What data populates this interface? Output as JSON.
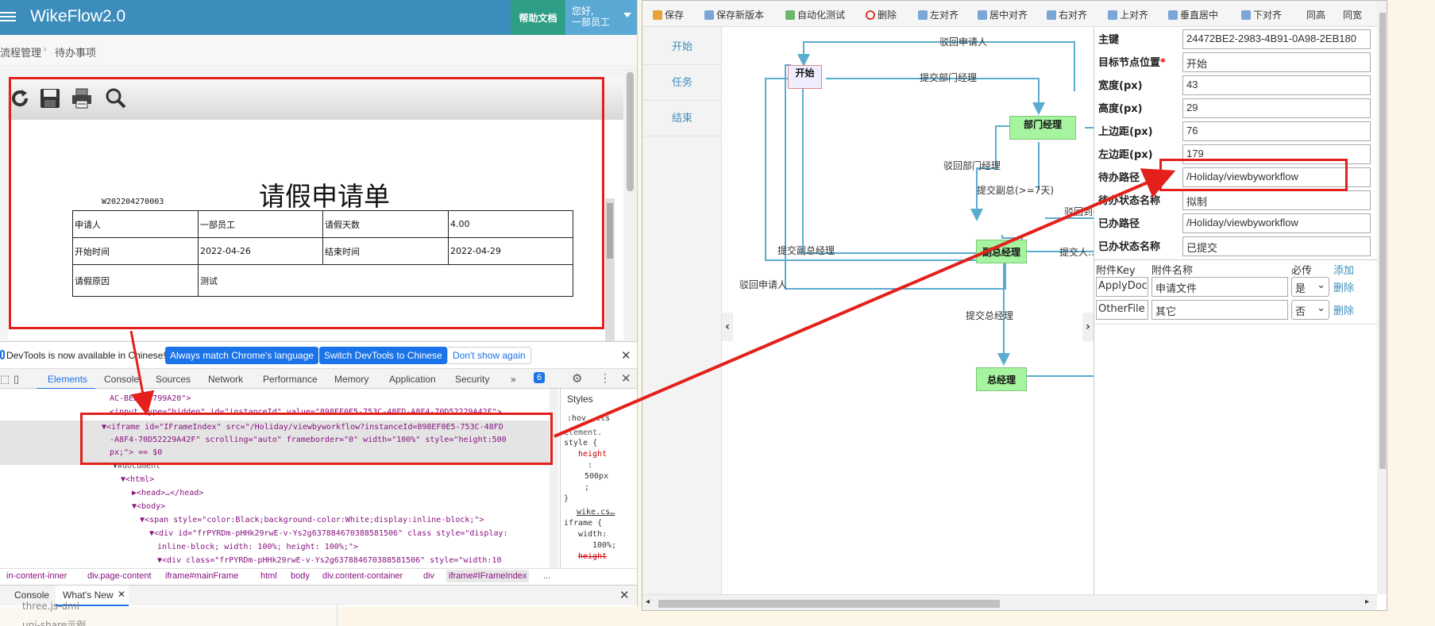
{
  "left": {
    "app_title": "WikeFlow2.0",
    "help_button": "帮助文档",
    "user_greeting": "您好,",
    "user_name": "一部员工",
    "breadcrumb": [
      "流程管理",
      "待办事项"
    ],
    "breadcrumb_sep": "›",
    "toolbar_icons": [
      "refresh-icon",
      "save-icon",
      "print-icon",
      "search-icon"
    ],
    "form": {
      "title": "请假申请单",
      "number": "W202204270003",
      "rows": [
        [
          "申请人",
          "一部员工",
          "请假天数",
          "4.00"
        ],
        [
          "开始时间",
          "2022-04-26",
          "结束时间",
          "2022-04-29"
        ],
        [
          "请假原因",
          "测试",
          "",
          ""
        ]
      ]
    }
  },
  "devtools": {
    "notice": "DevTools is now available in Chinese!",
    "btn_match": "Always match Chrome's language",
    "btn_switch": "Switch DevTools to Chinese",
    "btn_dont": "Don't show again",
    "tabs": [
      "Elements",
      "Console",
      "Sources",
      "Network",
      "Performance",
      "Memory",
      "Application",
      "Security"
    ],
    "more_tabs": "»",
    "issues_count": "6",
    "code_lines": [
      "AC-BEBBE5799A20\">",
      "<input type=\"hidden\" id=\"instanceId\" value=\"898EF0E5-753C-48FD-A8F4-70D52229A42F\">",
      "▼<iframe id=\"IFrameIndex\" src=\"/Holiday/viewbyworkflow?instanceId=898EF0E5-753C-48FD",
      "-A8F4-70D52229A42F\" scrolling=\"auto\" frameborder=\"0\" width=\"100%\" style=\"height:500",
      "px;\"> == $0",
      "▼#document",
      "▼<html>",
      "▶<head>…</head>",
      "▼<body>",
      "▼<span style=\"color:Black;background-color:White;display:inline-block;\">",
      "▼<div id=\"frPYRDm-pHHk29rwE-v-Ys2g637884670388581506\" class style=\"display:",
      "inline-block; width: 100%; height: 100%;\">",
      "▼<div class=\"frPYRDm-pHHk29rwE-v-Ys2g637884670388581506\" style=\"width:10"
    ],
    "styles_tab": "Styles",
    "styles_lines": [
      ":hov .cls",
      "element.",
      "style {",
      "height",
      ":",
      "500px",
      ";",
      "}",
      "wike.cs…",
      "iframe {",
      "width:",
      "100%;",
      "height"
    ],
    "crumbs": [
      "in-content-inner",
      "div.page-content",
      "iframe#mainFrame",
      "html",
      "body",
      "div.content-container",
      "div",
      "iframe#IFrameIndex",
      "..."
    ],
    "drawer_tabs": [
      "Console",
      "What's New"
    ],
    "below_items": [
      "three.js-dml",
      "uni-share示例"
    ]
  },
  "right": {
    "toolbar": [
      "保存",
      "保存新版本",
      "自动化测试",
      "删除",
      "左对齐",
      "居中对齐",
      "右对齐",
      "上对齐",
      "垂直居中",
      "下对齐",
      "同高",
      "同宽"
    ],
    "nav": [
      "开始",
      "任务",
      "结束"
    ],
    "nodes": {
      "start": "开始",
      "dept": "部门经理",
      "vp": "副总经理",
      "gm": "总经理"
    },
    "edge_labels": [
      "驳回申请人",
      "提交部门经理",
      "驳回部门经理",
      "提交副总(>=7天)",
      "驳回到…",
      "提交副总经理",
      "提交人…",
      "驳回申请人",
      "提交总经理"
    ],
    "properties": [
      {
        "label": "主键",
        "value": "24472BE2-2983-4B91-0A98-2EB180"
      },
      {
        "label": "目标节点位置",
        "value": "开始"
      },
      {
        "label": "宽度(px)",
        "value": "43"
      },
      {
        "label": "高度(px)",
        "value": "29"
      },
      {
        "label": "上边距(px)",
        "value": "76"
      },
      {
        "label": "左边距(px)",
        "value": "179"
      },
      {
        "label": "待办路径",
        "value": "/Holiday/viewbyworkflow"
      },
      {
        "label": "待办状态名称",
        "value": "拟制"
      },
      {
        "label": "已办路径",
        "value": "/Holiday/viewbyworkflow"
      },
      {
        "label": "已办状态名称",
        "value": "已提交"
      }
    ],
    "required_mark": "*",
    "attach_headers": [
      "附件Key",
      "附件名称",
      "必传",
      "添加"
    ],
    "attachments": [
      {
        "key": "ApplyDoc",
        "name": "申请文件",
        "required": "是",
        "action": "删除"
      },
      {
        "key": "OtherFile",
        "name": "其它",
        "required": "否",
        "action": "删除"
      }
    ]
  },
  "colors": {
    "topbar": "#3c8dbc",
    "help": "#2f9e86",
    "annotation_red": "#e3201b",
    "node_green": "#a6f3a0",
    "edge_blue": "#5aaccf"
  }
}
